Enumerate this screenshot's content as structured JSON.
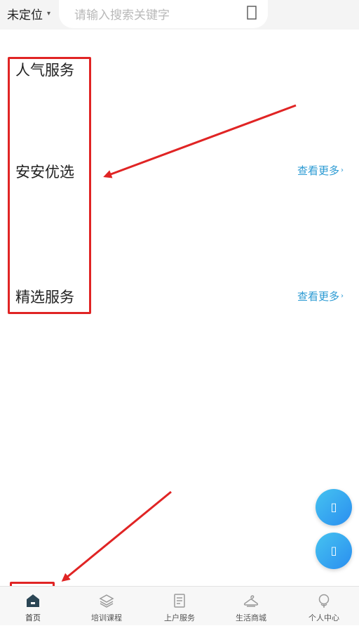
{
  "header": {
    "location_label": "未定位",
    "location_caret_icon": "caret-down-icon",
    "search_placeholder": "请输入搜索关键字",
    "search_icon": "search-icon"
  },
  "sections": [
    {
      "title": "人气服务",
      "more": ""
    },
    {
      "title": "安安优选",
      "more": "查看更多"
    },
    {
      "title": "精选服务",
      "more": "查看更多"
    }
  ],
  "floating_buttons": [
    {
      "icon": "headset-icon"
    },
    {
      "icon": "chat-icon"
    }
  ],
  "bottom_nav": [
    {
      "label": "首页",
      "icon": "home-icon",
      "active": true
    },
    {
      "label": "培训课程",
      "icon": "layers-icon",
      "active": false
    },
    {
      "label": "上户服务",
      "icon": "document-icon",
      "active": false
    },
    {
      "label": "生活商城",
      "icon": "hanger-icon",
      "active": false
    },
    {
      "label": "个人中心",
      "icon": "user-icon",
      "active": false
    }
  ],
  "colors": {
    "annotation": "#e02424",
    "link": "#2b9ad3",
    "fab_start": "#46c3f0",
    "fab_end": "#2a8ef0"
  }
}
